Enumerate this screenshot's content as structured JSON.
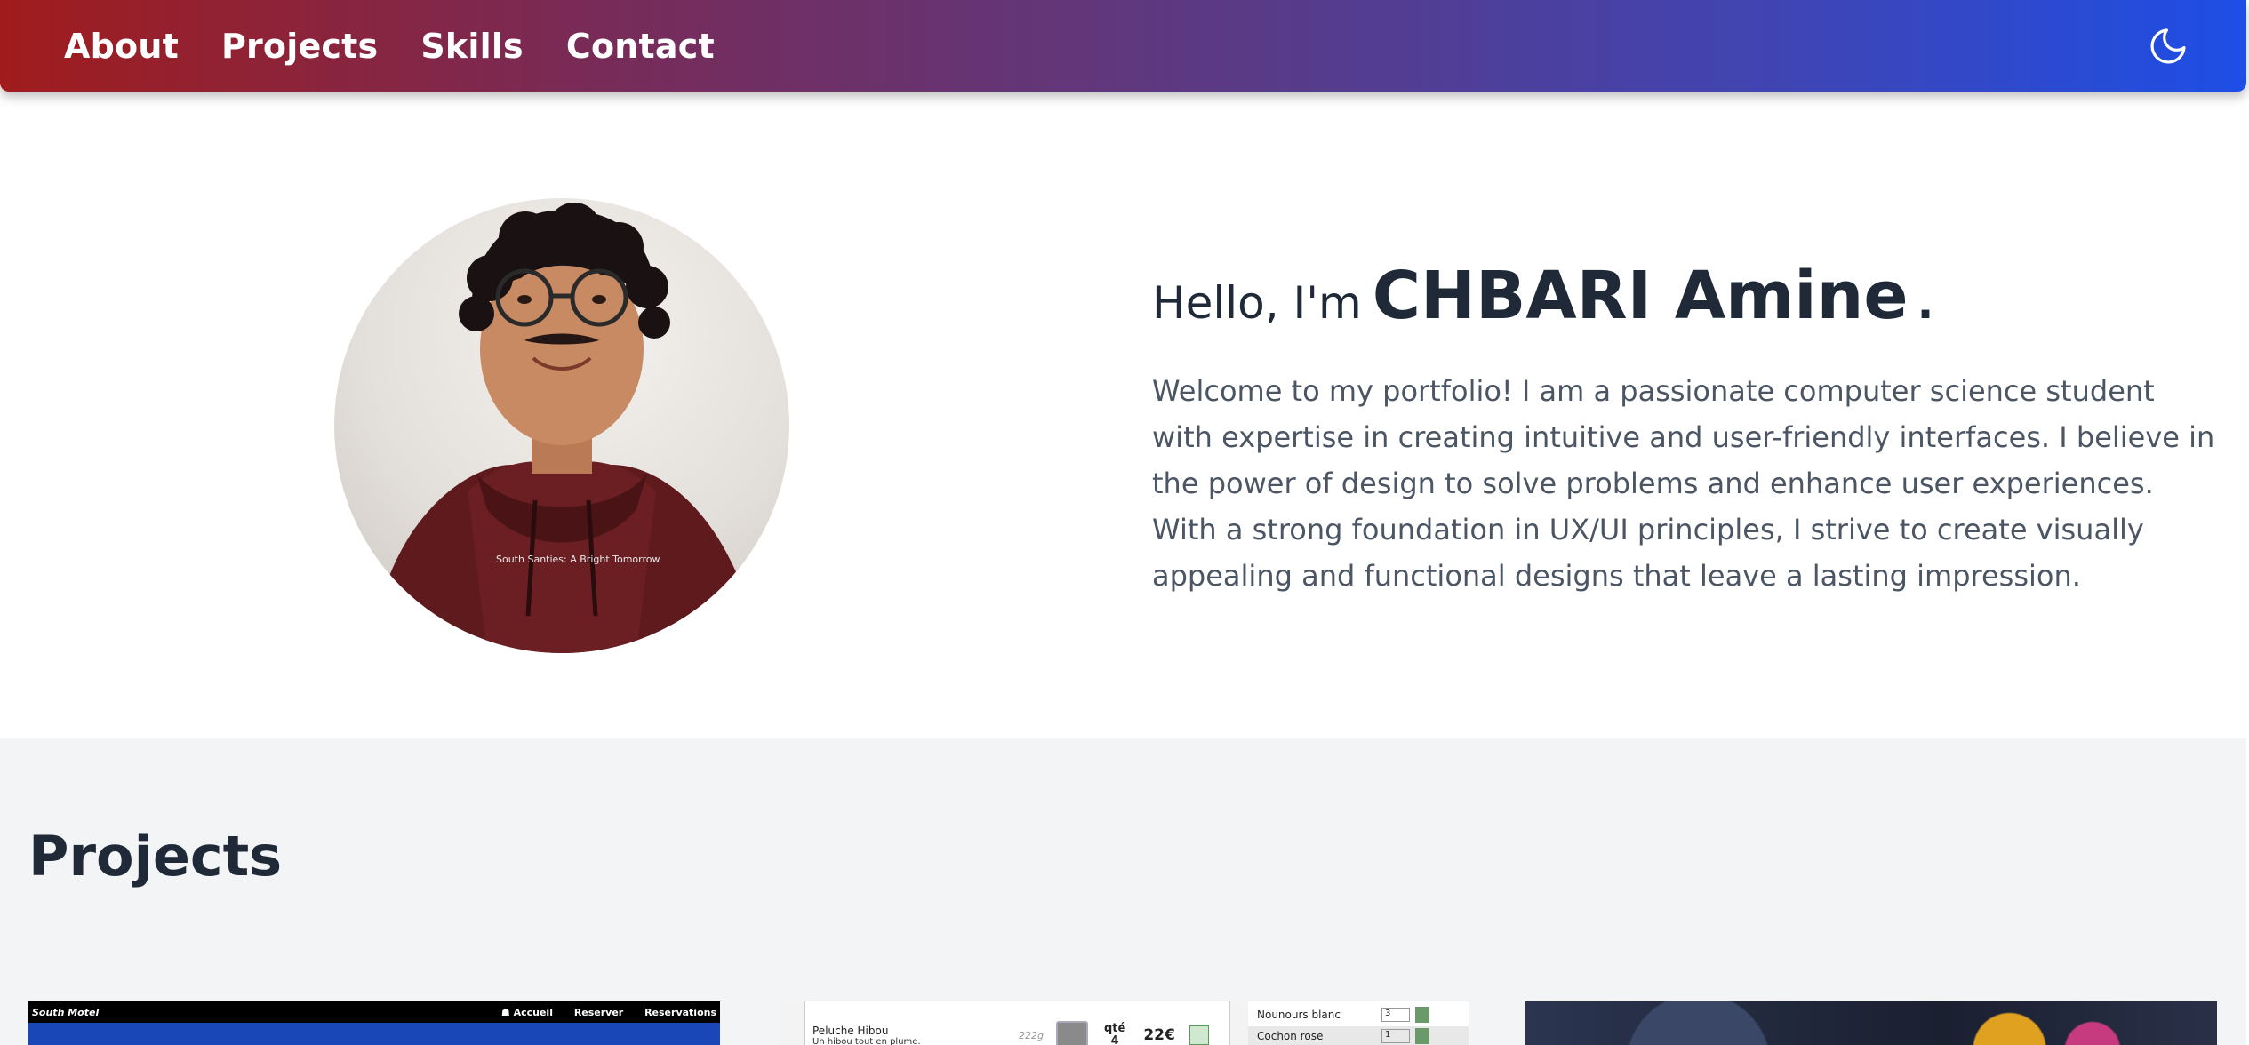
{
  "nav": {
    "links": [
      "About",
      "Projects",
      "Skills",
      "Contact"
    ],
    "theme_icon": "moon-icon"
  },
  "hero": {
    "greeting": "Hello, I'm",
    "name": "CHBARI Amine",
    "punct": ".",
    "intro": "Welcome to my portfolio! I am a passionate computer science student with expertise in creating intuitive and user-friendly interfaces. I believe in the power of design to solve problems and enhance user experiences. With a strong foundation in UX/UI principles, I strive to create visually appealing and functional designs that leave a lasting impression.",
    "photo_shirt_text": "South Santies: A Bright Tomorrow"
  },
  "projects": {
    "title": "Projects",
    "card1": {
      "brand": "South Motel",
      "nav": [
        "☗ Accueil",
        "Reserver",
        "Reservations"
      ]
    },
    "card2": {
      "product": "Peluche Hibou",
      "desc": "Un hibou tout en plume.",
      "weight": "222g",
      "qty_label": "qté",
      "qty_value": "4",
      "price": "22€",
      "cart": [
        {
          "label": "Nounours blanc",
          "qty": "3"
        },
        {
          "label": "Cochon rose",
          "qty": "1"
        }
      ]
    }
  },
  "colors": {
    "nav_gradient_start": "#a01c1c",
    "nav_gradient_end": "#1d4ee6",
    "heading": "#1f2937",
    "body_text": "#4b5563",
    "section_bg": "#f3f4f6"
  }
}
